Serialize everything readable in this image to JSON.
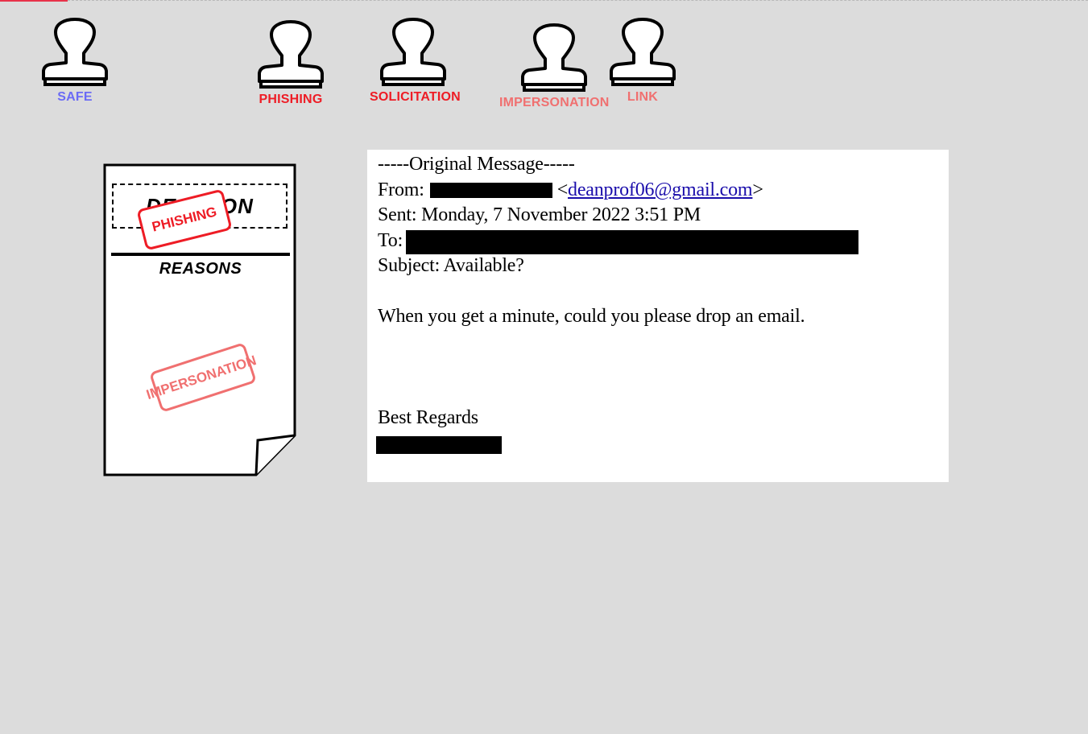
{
  "stamps": [
    {
      "id": "safe",
      "label": "SAFE",
      "color": "#6b6bf5"
    },
    {
      "id": "phishing",
      "label": "PHISHING",
      "color": "#ee1c25"
    },
    {
      "id": "solicitation",
      "label": "SOLICITATION",
      "color": "#ee1c25"
    },
    {
      "id": "impersonation",
      "label": "IMPERSONATION",
      "color": "#f07070"
    },
    {
      "id": "link",
      "label": "LINK",
      "color": "#f07070"
    }
  ],
  "document": {
    "decision_heading": "DECISION",
    "reasons_heading": "REASONS",
    "decision_stamp": {
      "label": "PHISHING",
      "color": "#ee1c25"
    },
    "reason_stamps": [
      {
        "label": "IMPERSONATION",
        "color": "#f07070"
      }
    ]
  },
  "email": {
    "header": "-----Original Message-----",
    "from_label": "From:",
    "from_email_open": "<",
    "from_email": "deanprof06@gmail.com",
    "from_email_close": ">",
    "sent": "Sent: Monday, 7 November 2022 3:51 PM",
    "to_label": "To:",
    "subject": "Subject: Available?",
    "body": "When you get a minute, could you please drop an email.",
    "closing": "Best Regards"
  },
  "colors": {
    "background": "#dcdcdc",
    "progress": "#e8334a",
    "link": "#1a0dab"
  }
}
